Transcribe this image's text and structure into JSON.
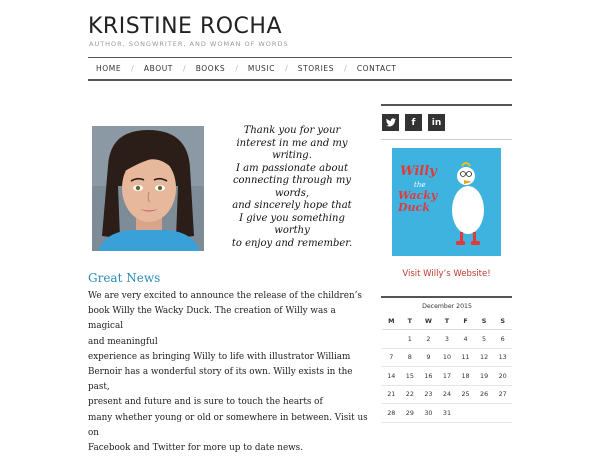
{
  "site": {
    "title": "KRISTINE ROCHA",
    "tagline": "AUTHOR, SONGWRITER, AND WOMAN OF WORDS"
  },
  "nav": {
    "items": [
      "HOME",
      "ABOUT",
      "BOOKS",
      "MUSIC",
      "STORIES",
      "CONTACT"
    ]
  },
  "intro": {
    "lines": [
      "Thank you for your",
      "interest in me and my",
      "writing.",
      "I am passionate about",
      "connecting through my",
      "words,",
      "and sincerely hope that",
      "I give you something",
      "worthy",
      "to enjoy and remember."
    ]
  },
  "news": {
    "title": "Great News",
    "lines": [
      "We are very excited to announce the release of the children’s",
      "book Willy the Wacky Duck. The creation of Willy was a magical",
      "and meaningful",
      "experience as bringing Willy to life with illustrator William",
      "Bernoir has a wonderful story of its own. Willy exists in the past,",
      "present and future and is sure to touch the hearts of",
      "many whether young or old or somewhere in between.  Visit us on",
      "Facebook and Twitter for more up to date news."
    ]
  },
  "sidebar": {
    "social": [
      {
        "icon": "twitter-icon",
        "glyph": "t"
      },
      {
        "icon": "facebook-icon",
        "glyph": "f"
      },
      {
        "icon": "linkedin-icon",
        "glyph": "in"
      }
    ],
    "book": {
      "title_top": "Willy",
      "title_mid": "the",
      "title_bottom": "Wacky Duck"
    },
    "willy_link": "Visit Willy’s Website!",
    "calendar": {
      "caption": "December 2015",
      "headers": [
        "M",
        "T",
        "W",
        "T",
        "F",
        "S",
        "S"
      ],
      "rows": [
        [
          "",
          "1",
          "2",
          "3",
          "4",
          "5",
          "6"
        ],
        [
          "7",
          "8",
          "9",
          "10",
          "11",
          "12",
          "13"
        ],
        [
          "14",
          "15",
          "16",
          "17",
          "18",
          "19",
          "20"
        ],
        [
          "21",
          "22",
          "23",
          "24",
          "25",
          "26",
          "27"
        ],
        [
          "28",
          "29",
          "30",
          "31",
          "",
          "",
          ""
        ]
      ]
    }
  },
  "colors": {
    "accent": "#2a8cb8",
    "link_red": "#c0392b",
    "social_bg": "#333333",
    "book_bg": "#3fb3e0"
  }
}
